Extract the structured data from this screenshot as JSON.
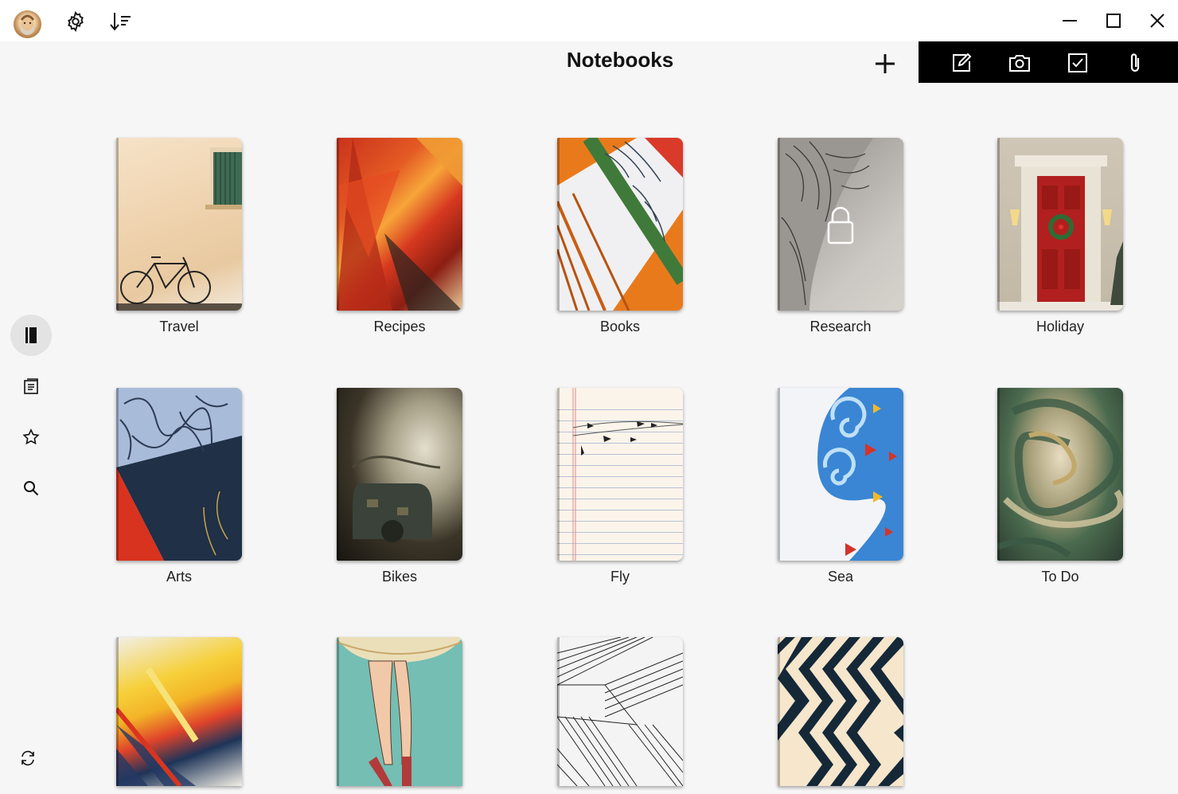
{
  "titlebar": {
    "icons": [
      "avatar",
      "gear-icon",
      "sort-icon"
    ],
    "window_controls": [
      "minimize-icon",
      "maximize-icon",
      "close-icon"
    ]
  },
  "header": {
    "title": "Notebooks",
    "add_icon": "plus-icon"
  },
  "quick_actions": [
    "new-note-icon",
    "camera-icon",
    "checkbox-icon",
    "paperclip-icon"
  ],
  "sidebar": {
    "items": [
      {
        "name": "notebooks",
        "icon": "notebook-icon",
        "active": true
      },
      {
        "name": "notes",
        "icon": "notes-icon",
        "active": false
      },
      {
        "name": "favorites",
        "icon": "star-icon",
        "active": false
      },
      {
        "name": "search",
        "icon": "search-icon",
        "active": false
      }
    ],
    "sync_icon": "sync-icon"
  },
  "notebooks": [
    {
      "label": "Travel",
      "locked": false
    },
    {
      "label": "Recipes",
      "locked": false
    },
    {
      "label": "Books",
      "locked": false
    },
    {
      "label": "Research",
      "locked": true
    },
    {
      "label": "Holiday",
      "locked": false
    },
    {
      "label": "Arts",
      "locked": false
    },
    {
      "label": "Bikes",
      "locked": false
    },
    {
      "label": "Fly",
      "locked": false
    },
    {
      "label": "Sea",
      "locked": false
    },
    {
      "label": "To Do",
      "locked": false
    },
    {
      "label": "",
      "locked": false
    },
    {
      "label": "",
      "locked": false
    },
    {
      "label": "",
      "locked": false
    },
    {
      "label": "",
      "locked": false
    }
  ],
  "colors": {
    "background": "#f6f6f6",
    "titlebar": "#ffffff",
    "quickbar": "#000000",
    "active_rail": "#e3e3e3"
  }
}
